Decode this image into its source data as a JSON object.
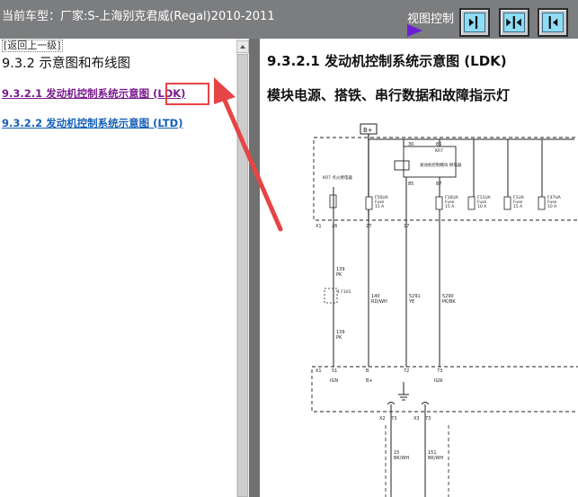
{
  "header": {
    "car_title": "当前车型：厂家:S-上海别克君威(Regal)2010-2011",
    "view_control_label": "视图控制",
    "view_buttons": [
      "expand-right",
      "split-center",
      "expand-left"
    ]
  },
  "left_pane": {
    "back_link": "[返回上一级]",
    "section_title": "9.3.2 示意图和布线图",
    "links": [
      {
        "label": "9.3.2.1 发动机控制系统示意图 (LDK)"
      },
      {
        "label": "9.3.2.2 发动机控制系统示意图 (LTD)"
      }
    ]
  },
  "right_pane": {
    "title": "9.3.2.1 发动机控制系统示意图 (LDK)",
    "subtitle": "模块电源、搭铁、串行数据和故障指示灯",
    "diagram": {
      "battery": "B+",
      "relay": "KR7",
      "relay_desc": "发动机控制模块\n继电器",
      "relay_pins": [
        "30",
        "86",
        "85",
        "87"
      ],
      "fuses": [
        {
          "name": "F50UA",
          "sub": "Fuse",
          "amp": "15 A"
        },
        {
          "name": "F16UA",
          "sub": "Fuse",
          "amp": "15 A"
        },
        {
          "name": "F11UA",
          "sub": "Fuse",
          "amp": "10 A"
        },
        {
          "name": "F1UA",
          "sub": "Fuse",
          "amp": "15 A"
        },
        {
          "name": "F47UA",
          "sub": "Fuse",
          "amp": "10 A"
        }
      ],
      "kr7_label": "KR7\n点火继电器",
      "connector_x1_top": "X1",
      "pins_top": [
        "26",
        "27",
        "17"
      ],
      "wires": [
        {
          "num": "139",
          "color": "PK"
        },
        {
          "num": "140",
          "color": "RD/WH"
        },
        {
          "num": "5291",
          "color": "YE"
        },
        {
          "num": "5290",
          "color": "PK/BK"
        }
      ],
      "fuse_block_label": "1 F101",
      "wire_bottom_left": {
        "num": "139",
        "color": "PK"
      },
      "connector_x1_bottom": "X1",
      "pins_bottom": [
        "51",
        "B",
        "72",
        "73"
      ],
      "pin_names": [
        "IGN",
        "B+",
        "",
        "IGN"
      ],
      "lower_connectors": [
        "X2",
        "X3"
      ],
      "lower_pins": [
        "73",
        "73"
      ],
      "lower_wires": [
        {
          "num": "15",
          "color": "BK/WH"
        },
        {
          "num": "151",
          "color": "BK/WH"
        }
      ]
    }
  },
  "colors": {
    "header_bg": "#7c7d7f",
    "link_visited": "#7a1b8d",
    "link_normal": "#1560b5",
    "highlight": "#e64545",
    "view_arrow": "#6a1fd6"
  }
}
